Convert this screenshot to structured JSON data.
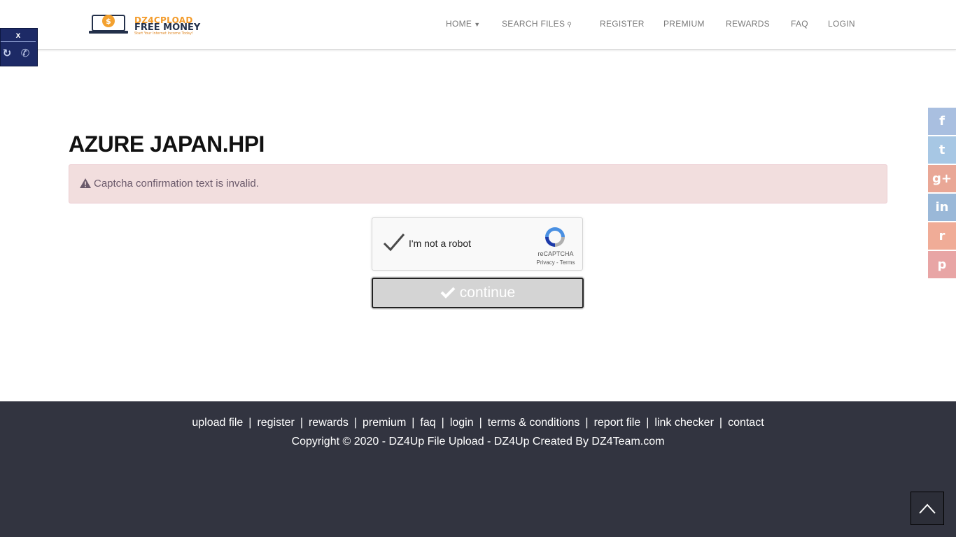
{
  "brand": {
    "title": "DZ4CPLOAD",
    "subtitle": "FREE MONEY",
    "tagline": "Start Your Internet Income Today!"
  },
  "nav": [
    {
      "label": "HOME",
      "icon": "caret-down-icon"
    },
    {
      "label": "SEARCH FILES",
      "icon": "search-icon"
    },
    {
      "label": "REGISTER"
    },
    {
      "label": "PREMIUM"
    },
    {
      "label": "REWARDS"
    },
    {
      "label": "FAQ"
    },
    {
      "label": "LOGIN"
    }
  ],
  "side_widget": {
    "close_label": "x"
  },
  "page": {
    "title": "AZURE JAPAN.HPI"
  },
  "alert": {
    "message": "Captcha confirmation text is invalid.",
    "bg_color": "#f2dede",
    "text_color": "#6b5a6b"
  },
  "captcha": {
    "label": "I'm not a robot",
    "brand": "reCAPTCHA",
    "privacy": "Privacy",
    "link_sep": "-",
    "terms": "Terms",
    "checked": true
  },
  "continue_button": {
    "label": "continue"
  },
  "share": [
    {
      "name": "facebook",
      "glyph": "f",
      "color": "#a9bfe0"
    },
    {
      "name": "twitter",
      "glyph": "t",
      "color": "#a7c7e4"
    },
    {
      "name": "google-plus",
      "glyph": "g+",
      "color": "#e9a796"
    },
    {
      "name": "linkedin",
      "glyph": "in",
      "color": "#9ab8d8"
    },
    {
      "name": "reddit",
      "glyph": "r",
      "color": "#f0ac97"
    },
    {
      "name": "pinterest",
      "glyph": "p",
      "color": "#e8a5a5"
    }
  ],
  "footer": {
    "links": [
      "upload file",
      "register",
      "rewards",
      "premium",
      "faq",
      "login",
      "terms & conditions",
      "report file",
      "link checker",
      "contact"
    ],
    "separator": "|",
    "copyright": "Copyright © 2020 - DZ4Up File Upload - DZ4Up Created By DZ4Team.com",
    "bg_color": "#323440"
  }
}
